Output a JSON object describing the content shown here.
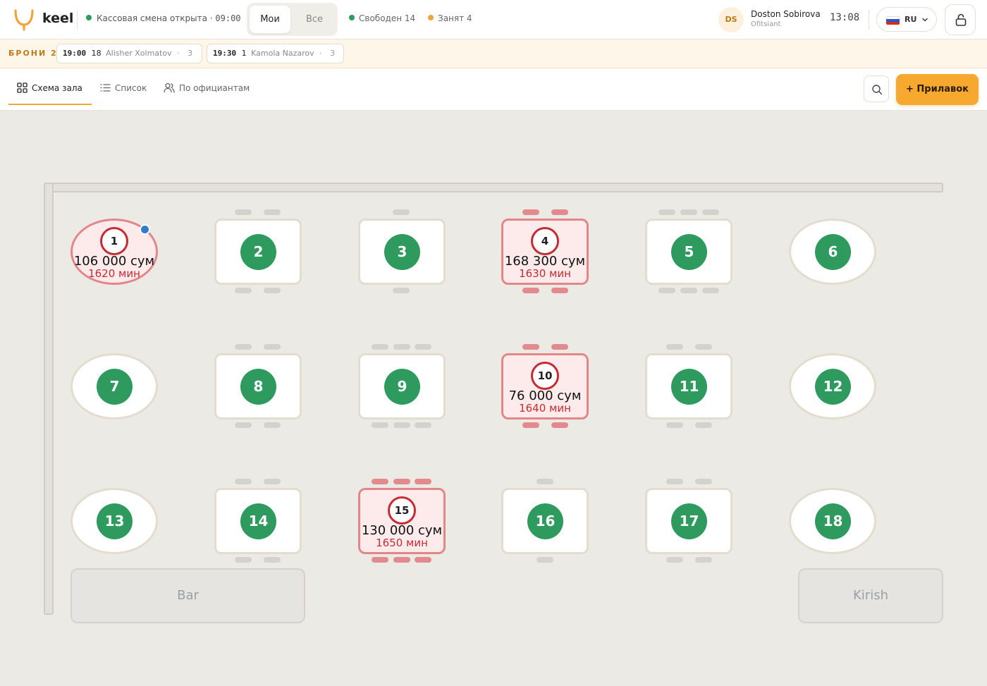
{
  "header": {
    "brand": "keel",
    "shift_status": "Кассовая смена открыта ·",
    "shift_time": "09:00",
    "filter": {
      "mine": "Мои",
      "all": "Все"
    },
    "free_label": "Свободен 14",
    "busy_label": "Занят 4",
    "user_initials": "DS",
    "user_name": "Doston Sobirova",
    "user_role": "Ofitsiant",
    "clock": "13:08",
    "language": "RU"
  },
  "colors": {
    "accent": "#F6A92E",
    "free": "#2E9A5E",
    "busy": "#C62A32",
    "notification": "#2F7DD1"
  },
  "reservations": {
    "label": "БРОНИ 2",
    "items": [
      {
        "time": "19:00",
        "table": "18",
        "name": "Alisher Xolmatov",
        "sep": "·",
        "guests": "3"
      },
      {
        "time": "19:30",
        "table": "1",
        "name": "Kamola Nazarov",
        "sep": "·",
        "guests": "3"
      }
    ]
  },
  "tabs": {
    "hall": "Схема зала",
    "list": "Список",
    "waiters": "По официантам"
  },
  "counter_button": "+ Прилавок",
  "zones": {
    "bar": "Bar",
    "entrance": "Kirish"
  },
  "tables": {
    "t1": {
      "num": "1",
      "amount": "106 000 сум",
      "time": "1620 мин",
      "status": "busy"
    },
    "t2": {
      "num": "2",
      "status": "free"
    },
    "t3": {
      "num": "3",
      "status": "free"
    },
    "t4": {
      "num": "4",
      "amount": "168 300 сум",
      "time": "1630 мин",
      "status": "busy"
    },
    "t5": {
      "num": "5",
      "status": "free"
    },
    "t6": {
      "num": "6",
      "status": "free"
    },
    "t7": {
      "num": "7",
      "status": "free"
    },
    "t8": {
      "num": "8",
      "status": "free"
    },
    "t9": {
      "num": "9",
      "status": "free"
    },
    "t10": {
      "num": "10",
      "amount": "76 000 сум",
      "time": "1640 мин",
      "status": "busy"
    },
    "t11": {
      "num": "11",
      "status": "free"
    },
    "t12": {
      "num": "12",
      "status": "free"
    },
    "t13": {
      "num": "13",
      "status": "free"
    },
    "t14": {
      "num": "14",
      "status": "free"
    },
    "t15": {
      "num": "15",
      "amount": "130 000 сум",
      "time": "1650 мин",
      "status": "busy"
    },
    "t16": {
      "num": "16",
      "status": "free"
    },
    "t17": {
      "num": "17",
      "status": "free"
    },
    "t18": {
      "num": "18",
      "status": "free"
    }
  }
}
